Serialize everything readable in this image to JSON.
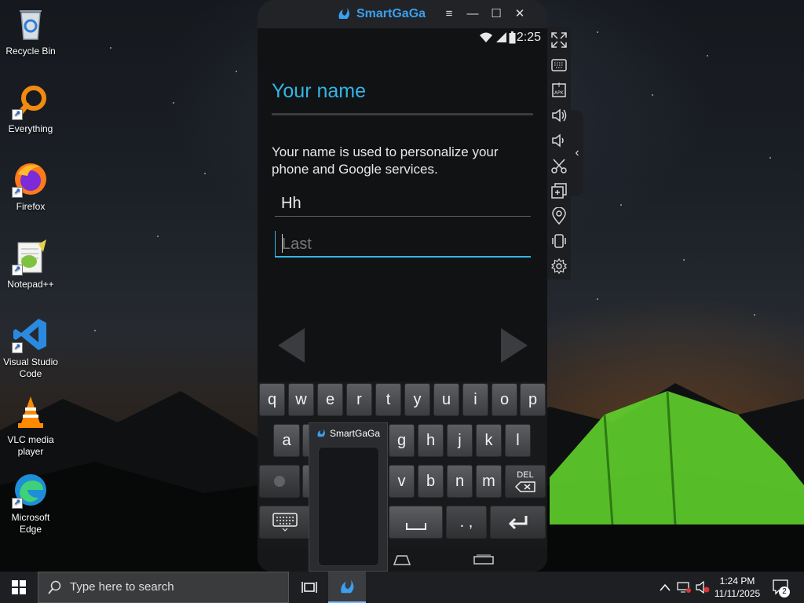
{
  "desktop": {
    "icons": [
      {
        "label": "Recycle Bin"
      },
      {
        "label": "Everything"
      },
      {
        "label": "Firefox"
      },
      {
        "label": "Notepad++"
      },
      {
        "label": "Visual Studio Code"
      },
      {
        "label": "VLC media player"
      },
      {
        "label": "Microsoft Edge"
      }
    ]
  },
  "emulator": {
    "title": "SmartGaGa",
    "menu_glyph": "≡",
    "minimize_glyph": "—",
    "maximize_glyph": "☐",
    "close_glyph": "✕",
    "status_time": "2:25",
    "screen": {
      "heading": "Your name",
      "description": "Your name is used to personalize your phone and Google services.",
      "first_name_value": "Hh",
      "last_name_placeholder": "Last"
    },
    "keyboard": {
      "row1": [
        "q",
        "w",
        "e",
        "r",
        "t",
        "y",
        "u",
        "i",
        "o",
        "p"
      ],
      "row2": [
        "a",
        "g",
        "h",
        "j",
        "k",
        "l"
      ],
      "row3": [
        "v",
        "b",
        "n",
        "m"
      ],
      "del_label": "DEL",
      "punct_label": ". ,"
    },
    "sidebar_tools": [
      "fullscreen-icon",
      "keyboard-icon",
      "apk-install-icon",
      "volume-up-icon",
      "volume-down-icon",
      "scissors-icon",
      "multi-instance-icon",
      "location-icon",
      "shake-icon",
      "settings-icon"
    ],
    "thumbnail": {
      "title": "SmartGaGa"
    }
  },
  "taskbar": {
    "search_placeholder": "Type here to search",
    "time": "1:24 PM",
    "date": "11/11/2025",
    "notification_count": "2"
  },
  "colors": {
    "android_accent": "#33b5e5",
    "smartgaga_blue": "#3aa0f0"
  }
}
